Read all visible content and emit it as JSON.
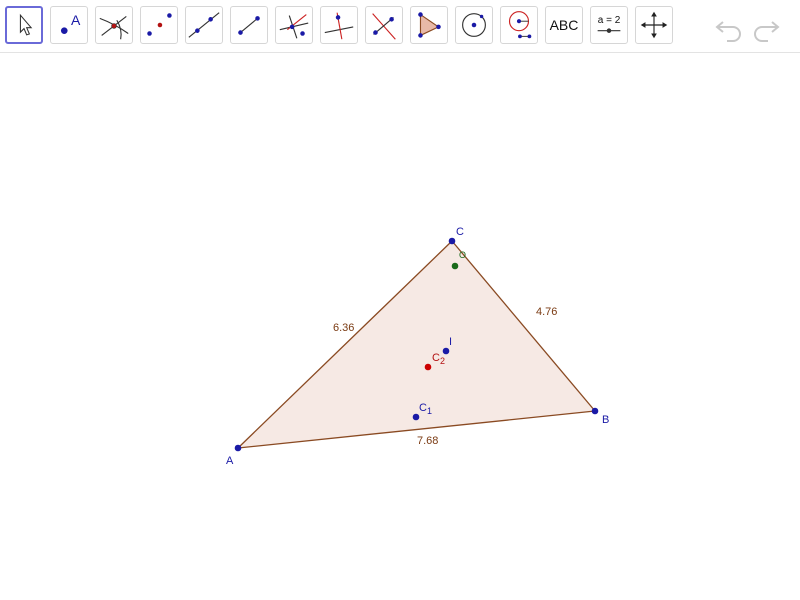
{
  "colors": {
    "point": "#1a1aa6",
    "segment": "#8a4a22",
    "fill": "#f6e9e4",
    "centroid": "#cc0000",
    "circumcenter": "#1a6a1a",
    "tool_border": "#d6d6d6",
    "selected_border": "#6a6ad8"
  },
  "toolbar": {
    "tools": [
      {
        "name": "move-tool",
        "icon": "arrow-cursor-icon"
      },
      {
        "name": "point-tool",
        "icon": "point-icon",
        "letter": "A"
      },
      {
        "name": "intersect-tool",
        "icon": "intersect-icon"
      },
      {
        "name": "midpoint-tool",
        "icon": "midpoint-icon"
      },
      {
        "name": "line-tool",
        "icon": "line-icon"
      },
      {
        "name": "segment-tool",
        "icon": "segment-icon"
      },
      {
        "name": "perpendicular-tool",
        "icon": "perpendicular-icon"
      },
      {
        "name": "perpendicular-bisector-tool",
        "icon": "perpendicular-bisector-icon"
      },
      {
        "name": "angle-bisector-tool",
        "icon": "angle-bisector-icon"
      },
      {
        "name": "polygon-tool",
        "icon": "polygon-icon"
      },
      {
        "name": "circle-tool",
        "icon": "circle-center-point-icon"
      },
      {
        "name": "circle-radius-tool",
        "icon": "compass-icon"
      },
      {
        "name": "text-tool",
        "icon": "text-icon",
        "label": "ABC"
      },
      {
        "name": "slider-tool",
        "icon": "slider-icon",
        "label": "a = 2"
      },
      {
        "name": "move-view-tool",
        "icon": "move-graphics-view-icon"
      }
    ],
    "undo_icon": "undo-icon",
    "redo_icon": "redo-icon"
  },
  "construction": {
    "points": {
      "A": "A",
      "B": "B",
      "C": "C",
      "C1": "C",
      "C1_sub": "1",
      "C2": "C",
      "C2_sub": "2",
      "I": "I",
      "O": "O"
    },
    "segments": {
      "AB": "7.68",
      "BC": "4.76",
      "CA": "6.36"
    }
  }
}
